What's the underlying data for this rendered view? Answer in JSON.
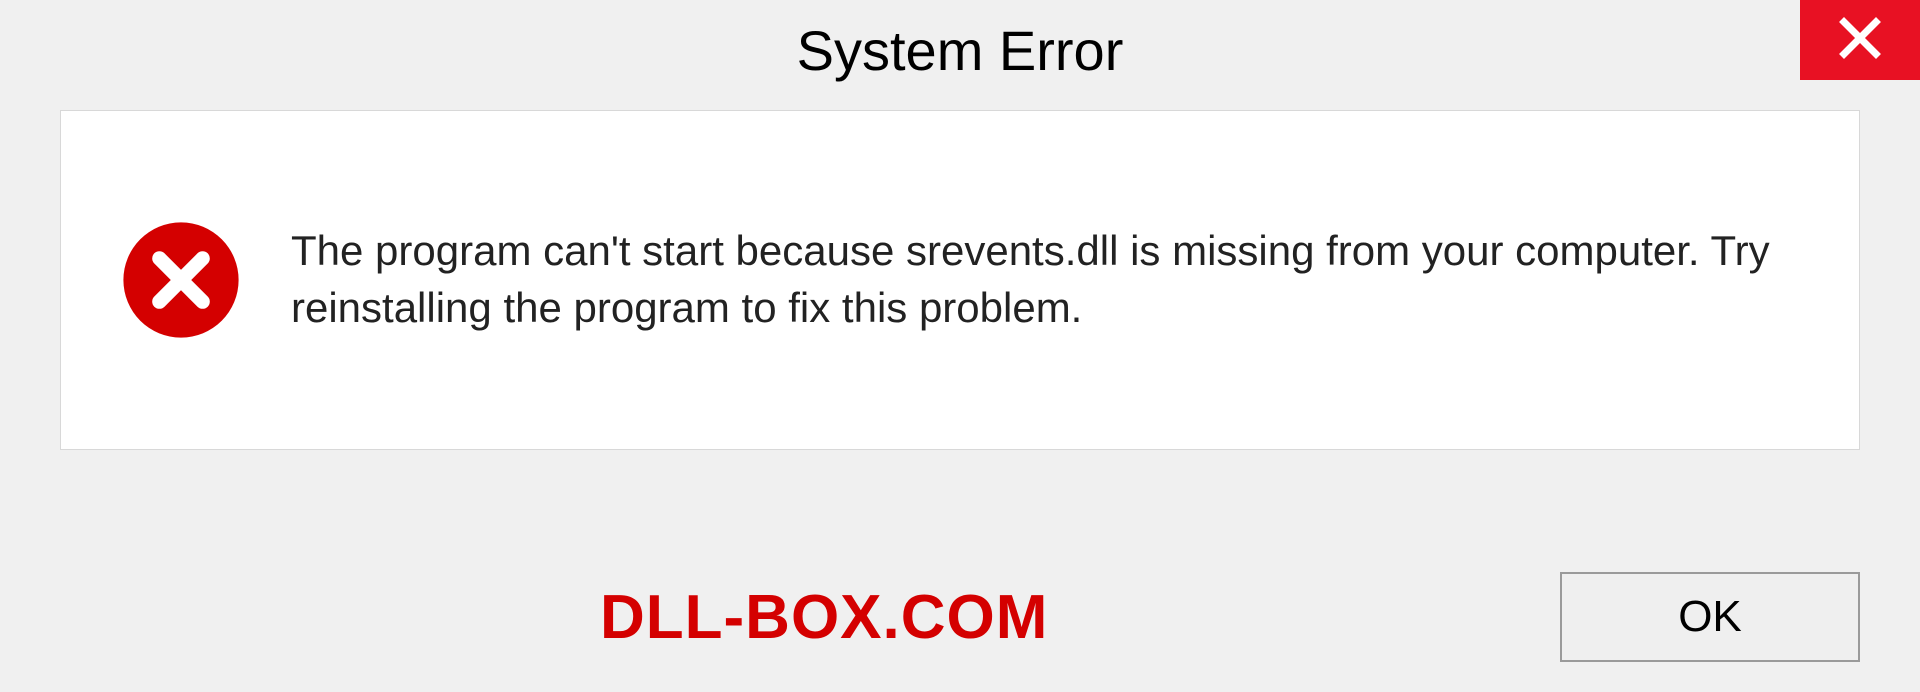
{
  "titlebar": {
    "title": "System Error"
  },
  "content": {
    "message": "The program can't start because srevents.dll is missing from your computer. Try reinstalling the program to fix this problem."
  },
  "footer": {
    "watermark": "DLL-BOX.COM",
    "ok_label": "OK"
  },
  "colors": {
    "close_bg": "#e81123",
    "error_icon": "#d40000",
    "watermark": "#d40000"
  }
}
